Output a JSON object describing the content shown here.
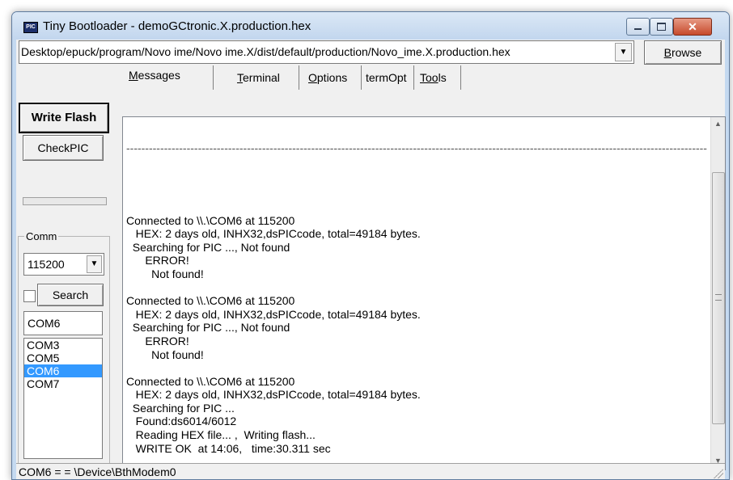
{
  "window": {
    "title": "Tiny Bootloader - demoGCtronic.X.production.hex",
    "icon": "pic-app-icon",
    "icon_text": "PIC",
    "close_glyph": "✕"
  },
  "path": {
    "value": "Desktop/epuck/program/Novo ime/Novo ime.X/dist/default/production/Novo_ime.X.production.hex",
    "dropdown_glyph": "▼"
  },
  "browse": {
    "mnemonic": "B",
    "rest": "rowse"
  },
  "left": {
    "write_flash": "Write Flash",
    "check_pic": "CheckPIC",
    "progress_fraction": 0,
    "comm_label": "Comm",
    "baud_value": "115200",
    "baud_dropdown": "▼",
    "search_checked": false,
    "search_label": "Search",
    "com_value": "COM6",
    "com_list": [
      "COM3",
      "COM5",
      "COM6",
      "COM7"
    ],
    "com_selected": "COM6"
  },
  "tabs": [
    {
      "mnemonic": "M",
      "rest": "essages",
      "active": true
    },
    {
      "mnemonic": "T",
      "rest": "erminal",
      "active": false
    },
    {
      "mnemonic": "O",
      "rest": "ptions",
      "active": false
    },
    {
      "mnemonic": "",
      "rest": "termOpt",
      "active": false
    },
    {
      "mnemonic": "Too",
      "rest": "ls",
      "active": false
    }
  ],
  "log": {
    "separator": "----------------------------------------------------------------------------------------------------------------------------------------------------------------------------------------",
    "lines": [
      "",
      "",
      "Connected to \\\\.\\COM6 at 115200",
      "   HEX: 2 days old, INHX32,dsPICcode, total=49184 bytes.",
      "  Searching for PIC ..., Not found",
      "      ERROR!",
      "        Not found!",
      "",
      "Connected to \\\\.\\COM6 at 115200",
      "   HEX: 2 days old, INHX32,dsPICcode, total=49184 bytes.",
      "  Searching for PIC ..., Not found",
      "      ERROR!",
      "        Not found!",
      "",
      "Connected to \\\\.\\COM6 at 115200",
      "   HEX: 2 days old, INHX32,dsPICcode, total=49184 bytes.",
      "  Searching for PIC ...",
      "   Found:ds6014/6012",
      "   Reading HEX file... ,  Writing flash...",
      "   WRITE OK  at 14:06,   time:30.311 sec"
    ]
  },
  "scroll": {
    "up": "▲",
    "down": "▼"
  },
  "status": {
    "text": "COM6 =  = \\Device\\BthModem0"
  }
}
